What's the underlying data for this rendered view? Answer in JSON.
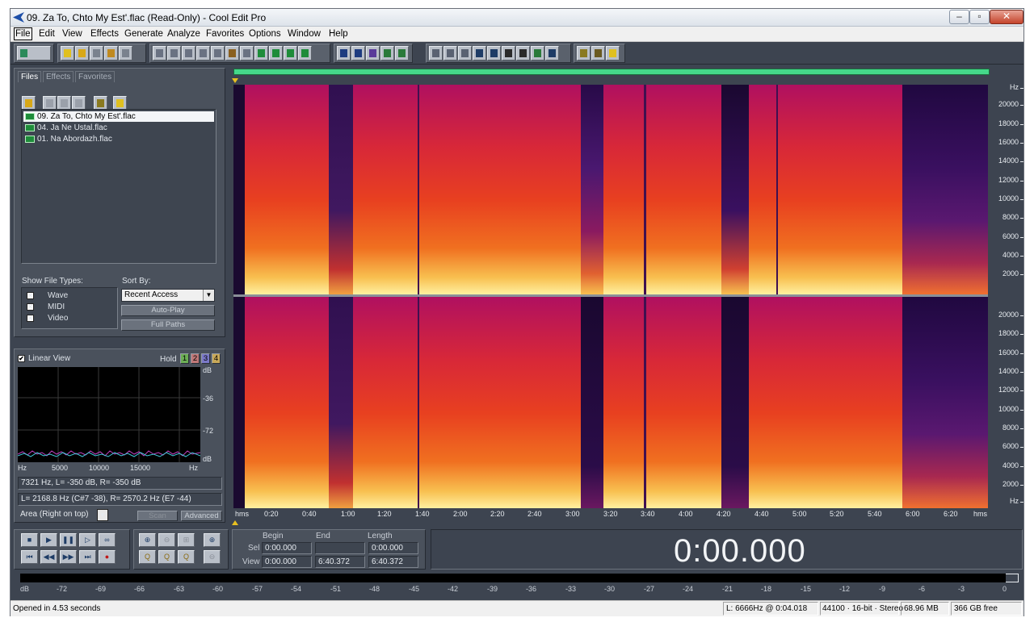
{
  "window": {
    "title": "09. Za To, Chto My Est'.flac (Read-Only) - Cool Edit Pro",
    "minimize": "‒",
    "maximize": "▫",
    "close": "✕"
  },
  "menu": [
    "File",
    "Edit",
    "View",
    "Effects",
    "Generate",
    "Analyze",
    "Favorites",
    "Options",
    "Window",
    "Help"
  ],
  "organizer": {
    "tabs": [
      "Files",
      "Effects",
      "Favorites"
    ],
    "files": [
      "09. Za To, Chto My Est'.flac",
      "04. Ja Ne Ustal.flac",
      "01. Na Abordazh.flac"
    ],
    "show_file_types_label": "Show File Types:",
    "file_types": [
      "Wave",
      "MIDI",
      "Video"
    ],
    "sort_by_label": "Sort By:",
    "sort_by_value": "Recent Access",
    "auto_play": "Auto-Play",
    "full_paths": "Full Paths"
  },
  "frequency_analysis": {
    "linear_view": "Linear View",
    "hold": "Hold",
    "hold_slots": [
      "1",
      "2",
      "3",
      "4"
    ],
    "db_labels": [
      "dB",
      "-36",
      "-72",
      "dB"
    ],
    "hz_labels": [
      "Hz",
      "5000",
      "10000",
      "15000",
      "Hz"
    ],
    "readout1": "7321 Hz, L= -350 dB, R= -350 dB",
    "readout2": "L= 2168.8 Hz (C#7 -38), R= 2570.2 Hz (E7 -44)",
    "mode_value": "Area (Right on top)",
    "scan": "Scan",
    "advanced": "Advanced"
  },
  "spectrogram": {
    "freq_unit": "Hz",
    "freq_ticks": [
      "20000",
      "18000",
      "16000",
      "14000",
      "12000",
      "10000",
      "8000",
      "6000",
      "4000",
      "2000"
    ],
    "time_ticks": [
      "hms",
      "0:20",
      "0:40",
      "1:00",
      "1:20",
      "1:40",
      "2:00",
      "2:20",
      "2:40",
      "3:00",
      "3:20",
      "3:40",
      "4:00",
      "4:20",
      "4:40",
      "5:00",
      "5:20",
      "5:40",
      "6:00",
      "6:20",
      "hms"
    ]
  },
  "selection": {
    "begin_label": "Begin",
    "end_label": "End",
    "length_label": "Length",
    "sel_label": "Sel",
    "view_label": "View",
    "sel_begin": "0:00.000",
    "sel_end": "",
    "sel_length": "0:00.000",
    "view_begin": "0:00.000",
    "view_end": "6:40.372",
    "view_length": "6:40.372"
  },
  "time_display": "0:00.000",
  "level_meter": [
    "dB",
    "-72",
    "-69",
    "-66",
    "-63",
    "-60",
    "-57",
    "-54",
    "-51",
    "-48",
    "-45",
    "-42",
    "-39",
    "-36",
    "-33",
    "-30",
    "-27",
    "-24",
    "-21",
    "-18",
    "-15",
    "-12",
    "-9",
    "-6",
    "-3",
    "0"
  ],
  "status": {
    "message": "Opened in 4.53 seconds",
    "cursor": "L: 6666Hz @  0:04.018",
    "format": "44100 · 16-bit · Stereo",
    "size": "68.96 MB",
    "free": "366 GB free"
  }
}
